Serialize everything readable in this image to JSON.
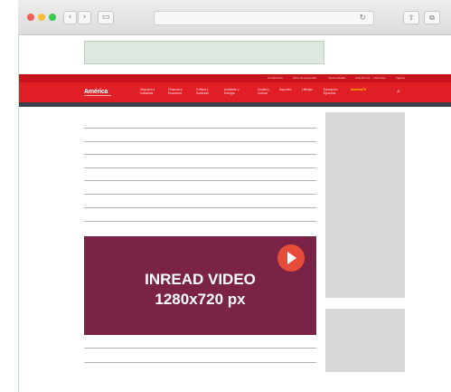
{
  "browser": {
    "traffic_lights": [
      "#f25f58",
      "#f8be3b",
      "#39c84a"
    ],
    "back": "‹",
    "forward": "›",
    "sidebar": "▭",
    "reload": "↻",
    "share": "⇧",
    "tabs": "⧉"
  },
  "site": {
    "brand_color": "#e01e25",
    "logo": "América",
    "top_links": [
      "Contáctanos",
      "Aviso de privacidad",
      "Oportunidades",
      "Lista Norma ... Oferentes",
      "Ingresa"
    ],
    "nav": [
      {
        "label": "Negocios e\nIndustrias",
        "highlight": false
      },
      {
        "label": "Finanzas y\nEconomía",
        "highlight": false
      },
      {
        "label": "Política y\nSociedad",
        "highlight": false
      },
      {
        "label": "Ambiente y\nEnergía",
        "highlight": false
      },
      {
        "label": "Ciudad y\nCultura",
        "highlight": false
      },
      {
        "label": "Deportes",
        "highlight": false
      },
      {
        "label": "Lifestyle",
        "highlight": false
      },
      {
        "label": "Educación\nEjecutiva",
        "highlight": false
      },
      {
        "label": "AméricaTV",
        "highlight": true
      }
    ],
    "search_icon": "⌕"
  },
  "video_ad": {
    "title": "INREAD VIDEO",
    "size": "1280x720 px",
    "background": "#7a2346",
    "play_color": "#e64c3a"
  }
}
